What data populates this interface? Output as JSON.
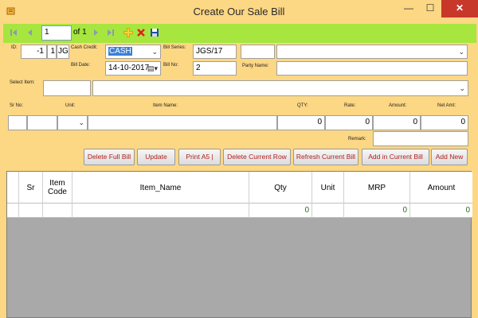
{
  "window": {
    "title": "Create Our Sale Bill",
    "minimize": "—",
    "maximize": "☐",
    "close": "✕"
  },
  "toolbar": {
    "position_value": "1",
    "of_label": "of 1",
    "icons": [
      "first-icon",
      "prev-icon",
      "next-icon",
      "last-icon",
      "add-icon",
      "delete-icon",
      "save-icon"
    ]
  },
  "form": {
    "id_label": "ID:",
    "id_value": "-1",
    "id_value2": "1",
    "prefix_value": "JG",
    "cash_credit_label": "Cash Credit:",
    "cash_credit_value": "CASH",
    "bill_date_label": "Bill Date:",
    "bill_date_value": "14-10-2017",
    "bill_series_label": "Bill Series:",
    "bill_series_value": "JGS/17",
    "bill_no_label": "Bill No:",
    "bill_no_value": "2",
    "party_name_label": "Party Name:",
    "party_code_value": "",
    "party_name_value": "",
    "party_name2_value": "",
    "select_item_label": "Select Item:",
    "select_item_code": "",
    "select_item_value": ""
  },
  "line_entry": {
    "headers": {
      "sr_no": "Sr No:",
      "unit": "Unit:",
      "item_name": "Item Name:",
      "qty": "QTY:",
      "rate": "Rate:",
      "amount": "Amount:",
      "net_amt": "Net Amt:"
    },
    "values": {
      "sr_no": "",
      "code": "",
      "unit": "",
      "item_name": "",
      "qty": "0",
      "rate": "0",
      "amount": "0",
      "net_amt": "0"
    },
    "remark_label": "Remark:",
    "remark_value": ""
  },
  "buttons": {
    "delete_full_bill": "Delete Full Bill",
    "update": "Update",
    "print_a5": "Print A5 |",
    "delete_current_row": "Delete Current Row",
    "refresh_current_bill": "Refresh Current Bill",
    "add_in_current_bill": "Add in Current Bill",
    "add_new": "Add New"
  },
  "grid": {
    "columns": [
      "",
      "Sr",
      "Item Code",
      "Item_Name",
      "Qty",
      "Unit",
      "MRP",
      "Amount"
    ],
    "rows": [
      [
        "",
        "",
        "",
        "",
        "0",
        "",
        "0",
        "0"
      ]
    ]
  },
  "colors": {
    "window_bg": "#fcd784",
    "toolbar_bg": "#a6e63f",
    "button_text": "#b02020",
    "grid_bg": "#a9a9a9",
    "close_bg": "#c7372a"
  }
}
